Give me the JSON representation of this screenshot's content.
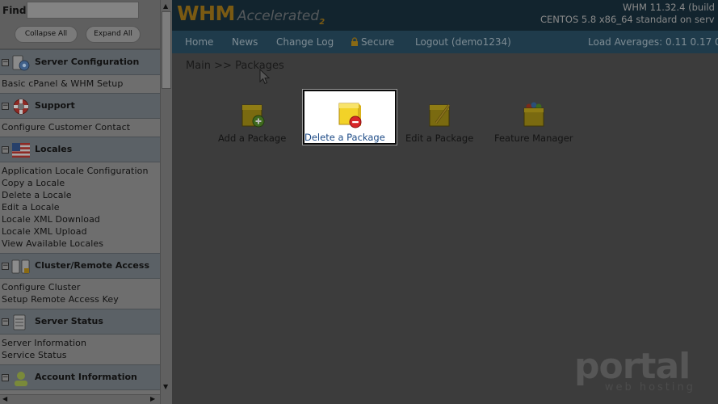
{
  "sidebar": {
    "find_label": "Find",
    "find_value": "",
    "collapse_all": "Collapse All",
    "expand_all": "Expand All",
    "sections": [
      {
        "title": "Server Configuration",
        "icon": "server-config-icon",
        "toggle": "−",
        "items": [
          "Basic cPanel & WHM Setup"
        ]
      },
      {
        "title": "Support",
        "icon": "lifebuoy-icon",
        "toggle": "−",
        "items": [
          "Configure Customer Contact"
        ]
      },
      {
        "title": "Locales",
        "icon": "us-flag-icon",
        "toggle": "−",
        "items": [
          "Application Locale Configuration",
          "Copy a Locale",
          "Delete a Locale",
          "Edit a Locale",
          "Locale XML Download",
          "Locale XML Upload",
          "View Available Locales"
        ]
      },
      {
        "title": "Cluster/Remote Access",
        "icon": "cluster-icon",
        "toggle": "−",
        "items": [
          "Configure Cluster",
          "Setup Remote Access Key"
        ]
      },
      {
        "title": "Server Status",
        "icon": "server-status-icon",
        "toggle": "−",
        "items": [
          "Server Information",
          "Service Status"
        ]
      },
      {
        "title": "Account Information",
        "icon": "account-info-icon",
        "toggle": "−",
        "items": []
      }
    ]
  },
  "header": {
    "logo_main": "WHM",
    "logo_sub": "Accelerated",
    "logo_num": "2",
    "version": "WHM 11.32.4 (build",
    "os": "CENTOS 5.8 x86_64 standard on serv"
  },
  "nav": {
    "home": "Home",
    "news": "News",
    "changelog": "Change Log",
    "secure": "Secure",
    "logout": "Logout (demo1234)",
    "load_averages": "Load Averages: 0.11 0.17 0"
  },
  "breadcrumb": "Main >> Packages",
  "packages": {
    "add": "Add a Package",
    "delete": "Delete a Package",
    "edit": "Edit a Package",
    "feature": "Feature Manager"
  },
  "watermark": {
    "text": "portal",
    "sub": "web hosting"
  },
  "colors": {
    "header_bg": "#12242e",
    "nav_bg": "#1f3b4b",
    "highlight_label": "#1c4a86"
  }
}
